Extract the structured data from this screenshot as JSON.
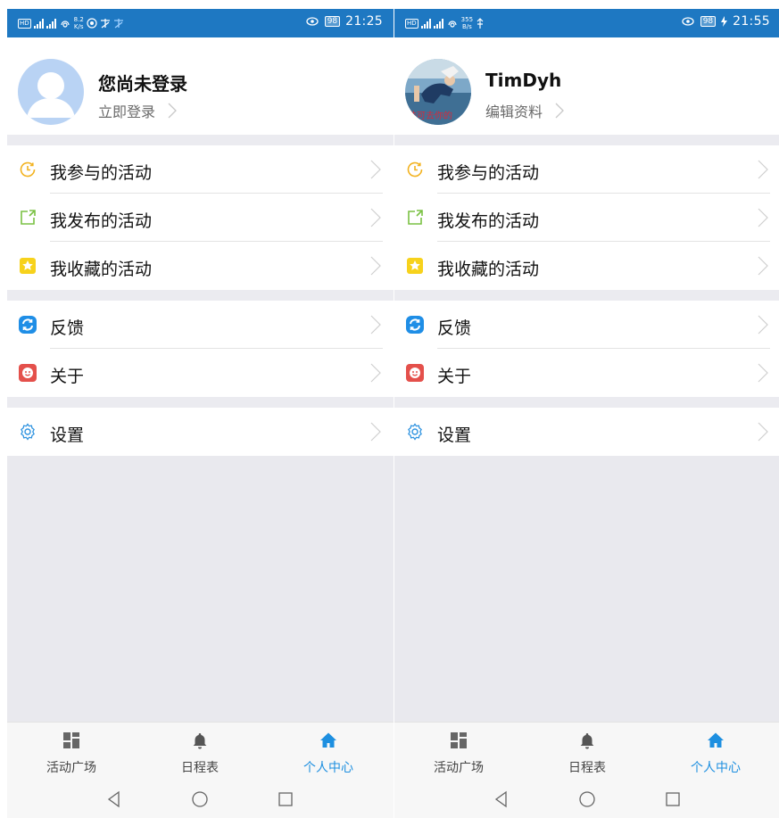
{
  "screens": [
    {
      "status": {
        "left_indicators": "HD 2G 4G",
        "net_speed_top": "8.2",
        "net_speed_unit": "K/s",
        "battery": "98",
        "time": "21:25"
      },
      "profile": {
        "name": "您尚未登录",
        "action": "立即登录",
        "avatar": "default-avatar"
      },
      "menu": {
        "participated": "我参与的活动",
        "published": "我发布的活动",
        "favorites": "我收藏的活动",
        "feedback": "反馈",
        "about": "关于",
        "settings": "设置"
      },
      "tabs": [
        "活动广场",
        "日程表",
        "个人中心"
      ],
      "active_tab": 2
    },
    {
      "status": {
        "left_indicators": "HD 2G 4G",
        "net_speed_top": "355",
        "net_speed_unit": "B/s",
        "battery": "98",
        "time": "21:55"
      },
      "profile": {
        "name": "TimDyh",
        "action": "编辑资料",
        "avatar": "user-photo",
        "avatar_caption": "洗可去你的"
      },
      "menu": {
        "participated": "我参与的活动",
        "published": "我发布的活动",
        "favorites": "我收藏的活动",
        "feedback": "反馈",
        "about": "关于",
        "settings": "设置"
      },
      "tabs": [
        "活动广场",
        "日程表",
        "个人中心"
      ],
      "active_tab": 2
    }
  ],
  "colors": {
    "status_bar": "#1e78c2",
    "accent": "#1d8fe0",
    "section_gap": "#ebebf0",
    "icon_clock": "#f2b21f",
    "icon_publish": "#7ac143",
    "icon_star": "#f7d21c",
    "icon_feedback": "#1f8ee6",
    "icon_about": "#e4504b",
    "icon_settings": "#2f93e0"
  }
}
